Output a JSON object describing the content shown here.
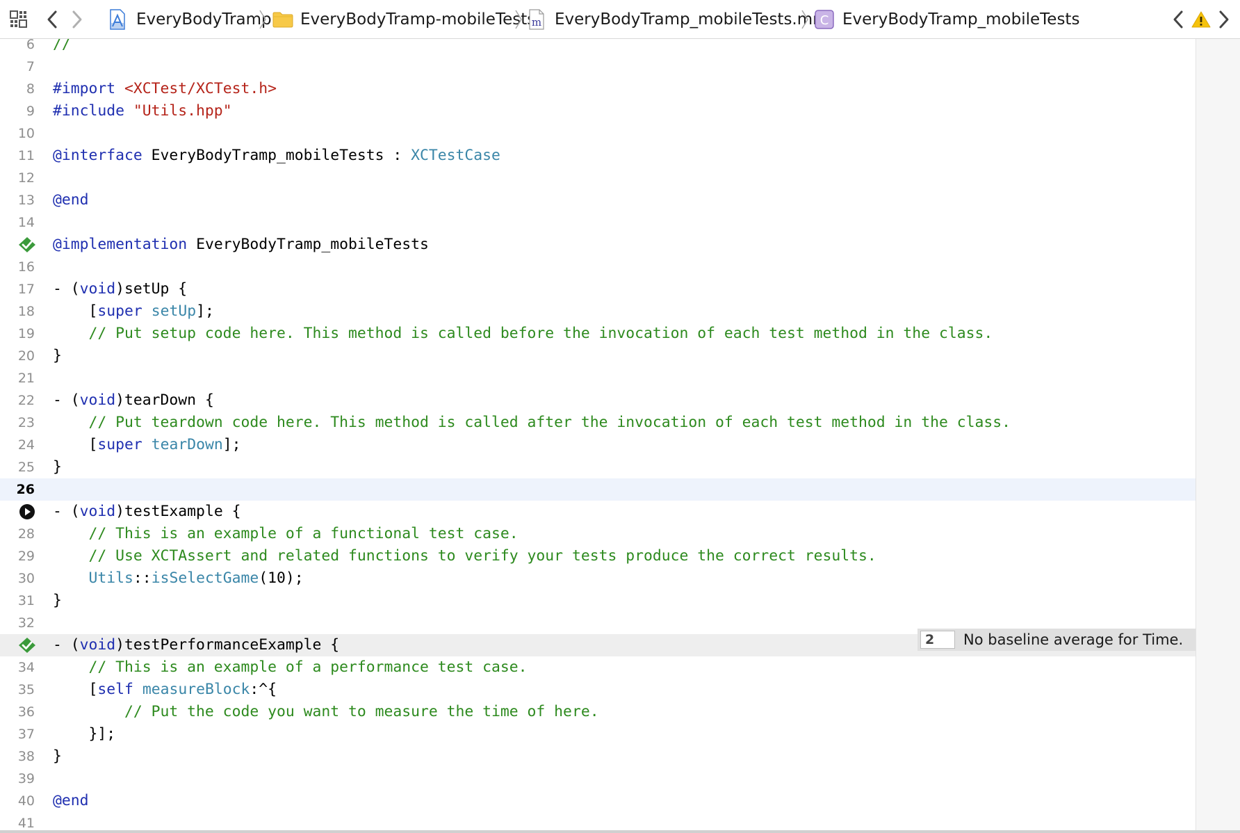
{
  "jumpbar": {
    "crumbs": [
      {
        "label": "EveryBodyTramp",
        "icon": "xcode-project-icon"
      },
      {
        "label": "EveryBodyTramp-mobileTests",
        "icon": "folder-icon"
      },
      {
        "label": "EveryBodyTramp_mobileTests.mm",
        "icon": "objc-file-icon"
      },
      {
        "label": "EveryBodyTramp_mobileTests",
        "icon": "class-icon"
      }
    ],
    "class_icon_letter": "C",
    "file_icon_letter": "m"
  },
  "colors": {
    "keyword": "#1f2fb0",
    "comment": "#2d8a1e",
    "string": "#b5241a",
    "type": "#3a86a8",
    "test_pass": "#3a9a3a",
    "current_line": "#eef3fc"
  },
  "editor": {
    "first_partial_line": {
      "number": "6",
      "text": "//"
    },
    "current_line": 26,
    "lines": [
      {
        "n": "7",
        "tokens": []
      },
      {
        "n": "8",
        "tokens": [
          {
            "t": "#import ",
            "c": "keyword"
          },
          {
            "t": "<XCTest/XCTest.h>",
            "c": "string"
          }
        ]
      },
      {
        "n": "9",
        "tokens": [
          {
            "t": "#include ",
            "c": "keyword"
          },
          {
            "t": "\"Utils.hpp\"",
            "c": "string"
          }
        ]
      },
      {
        "n": "10",
        "tokens": []
      },
      {
        "n": "11",
        "tokens": [
          {
            "t": "@interface",
            "c": "keyword"
          },
          {
            "t": " EveryBodyTramp_mobileTests : ",
            "c": "plain"
          },
          {
            "t": "XCTestCase",
            "c": "type"
          }
        ]
      },
      {
        "n": "12",
        "tokens": []
      },
      {
        "n": "13",
        "tokens": [
          {
            "t": "@end",
            "c": "keyword"
          }
        ]
      },
      {
        "n": "14",
        "tokens": []
      },
      {
        "n": "15",
        "gutter": "pass",
        "tokens": [
          {
            "t": "@implementation",
            "c": "keyword"
          },
          {
            "t": " EveryBodyTramp_mobileTests",
            "c": "plain"
          }
        ]
      },
      {
        "n": "16",
        "tokens": []
      },
      {
        "n": "17",
        "tokens": [
          {
            "t": "- (",
            "c": "plain"
          },
          {
            "t": "void",
            "c": "keyword"
          },
          {
            "t": ")setUp {",
            "c": "plain"
          }
        ]
      },
      {
        "n": "18",
        "tokens": [
          {
            "t": "    [",
            "c": "plain"
          },
          {
            "t": "super",
            "c": "keyword"
          },
          {
            "t": " ",
            "c": "plain"
          },
          {
            "t": "setUp",
            "c": "method"
          },
          {
            "t": "];",
            "c": "plain"
          }
        ]
      },
      {
        "n": "19",
        "tokens": [
          {
            "t": "    // Put setup code here. This method is called before the invocation of each test method in the class.",
            "c": "comment"
          }
        ]
      },
      {
        "n": "20",
        "tokens": [
          {
            "t": "}",
            "c": "plain"
          }
        ]
      },
      {
        "n": "21",
        "tokens": []
      },
      {
        "n": "22",
        "tokens": [
          {
            "t": "- (",
            "c": "plain"
          },
          {
            "t": "void",
            "c": "keyword"
          },
          {
            "t": ")tearDown {",
            "c": "plain"
          }
        ]
      },
      {
        "n": "23",
        "tokens": [
          {
            "t": "    // Put teardown code here. This method is called after the invocation of each test method in the class.",
            "c": "comment"
          }
        ]
      },
      {
        "n": "24",
        "tokens": [
          {
            "t": "    [",
            "c": "plain"
          },
          {
            "t": "super",
            "c": "keyword"
          },
          {
            "t": " ",
            "c": "plain"
          },
          {
            "t": "tearDown",
            "c": "method"
          },
          {
            "t": "];",
            "c": "plain"
          }
        ]
      },
      {
        "n": "25",
        "tokens": [
          {
            "t": "}",
            "c": "plain"
          }
        ]
      },
      {
        "n": "26",
        "current": true,
        "tokens": []
      },
      {
        "n": "27",
        "gutter": "run",
        "tokens": [
          {
            "t": "- (",
            "c": "plain"
          },
          {
            "t": "void",
            "c": "keyword"
          },
          {
            "t": ")testExample {",
            "c": "plain"
          }
        ]
      },
      {
        "n": "28",
        "tokens": [
          {
            "t": "    // This is an example of a functional test case.",
            "c": "comment"
          }
        ]
      },
      {
        "n": "29",
        "tokens": [
          {
            "t": "    // Use XCTAssert and related functions to verify your tests produce the correct results.",
            "c": "comment"
          }
        ]
      },
      {
        "n": "30",
        "tokens": [
          {
            "t": "    ",
            "c": "plain"
          },
          {
            "t": "Utils",
            "c": "type"
          },
          {
            "t": "::",
            "c": "plain"
          },
          {
            "t": "isSelectGame",
            "c": "method"
          },
          {
            "t": "(10);",
            "c": "plain"
          }
        ]
      },
      {
        "n": "31",
        "tokens": [
          {
            "t": "}",
            "c": "plain"
          }
        ]
      },
      {
        "n": "32",
        "tokens": []
      },
      {
        "n": "33",
        "gutter": "pass",
        "highlighted": true,
        "tokens": [
          {
            "t": "- (",
            "c": "plain"
          },
          {
            "t": "void",
            "c": "keyword"
          },
          {
            "t": ")testPerformanceExample {",
            "c": "plain"
          }
        ]
      },
      {
        "n": "34",
        "tokens": [
          {
            "t": "    // This is an example of a performance test case.",
            "c": "comment"
          }
        ]
      },
      {
        "n": "35",
        "tokens": [
          {
            "t": "    [",
            "c": "plain"
          },
          {
            "t": "self",
            "c": "keyword"
          },
          {
            "t": " ",
            "c": "plain"
          },
          {
            "t": "measureBlock",
            "c": "method"
          },
          {
            "t": ":^{",
            "c": "plain"
          }
        ]
      },
      {
        "n": "36",
        "tokens": [
          {
            "t": "        // Put the code you want to measure the time of here.",
            "c": "comment"
          }
        ]
      },
      {
        "n": "37",
        "tokens": [
          {
            "t": "    }];",
            "c": "plain"
          }
        ]
      },
      {
        "n": "38",
        "tokens": [
          {
            "t": "}",
            "c": "plain"
          }
        ]
      },
      {
        "n": "39",
        "tokens": []
      },
      {
        "n": "40",
        "tokens": [
          {
            "t": "@end",
            "c": "keyword"
          }
        ]
      },
      {
        "n": "41",
        "tokens": []
      }
    ]
  },
  "performance_badge": {
    "count": "2",
    "message": "No baseline average for Time."
  }
}
